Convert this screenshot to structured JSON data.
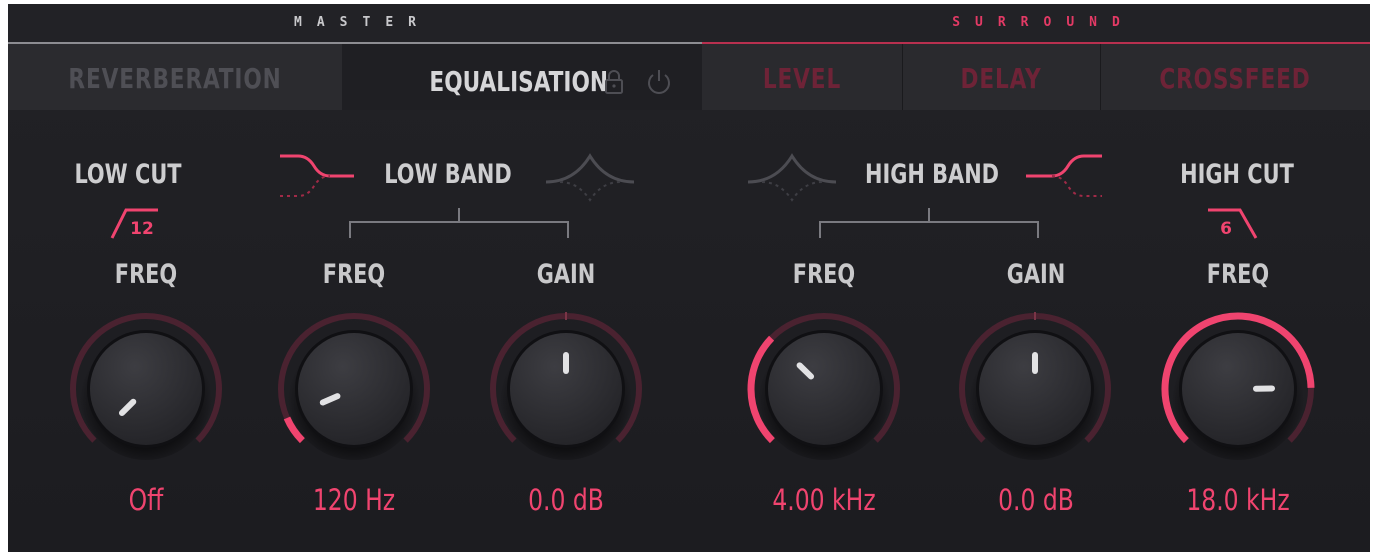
{
  "sections": {
    "master": "MASTER",
    "surround": "SURROUND"
  },
  "tabs": [
    {
      "label": "REVERBERATION",
      "active": false
    },
    {
      "label": "EQUALISATION",
      "active": true
    },
    {
      "label": "LEVEL",
      "active": false
    },
    {
      "label": "DELAY",
      "active": false
    },
    {
      "label": "CROSSFEED",
      "active": false
    }
  ],
  "icons": {
    "lock": "lock-icon",
    "power": "power-icon"
  },
  "eq": {
    "low_cut": {
      "title": "LOW CUT",
      "slope": "12",
      "param": "FREQ",
      "value": "Off",
      "level": 0.0
    },
    "low_band": {
      "title": "LOW BAND",
      "freq": {
        "param": "FREQ",
        "value": "120 Hz",
        "level": 0.08
      },
      "gain": {
        "param": "GAIN",
        "value": "0.0 dB",
        "level": 0.5
      }
    },
    "high_band": {
      "title": "HIGH BAND",
      "freq": {
        "param": "FREQ",
        "value": "4.00 kHz",
        "level": 0.33
      },
      "gain": {
        "param": "GAIN",
        "value": "0.0 dB",
        "level": 0.5
      }
    },
    "high_cut": {
      "title": "HIGH CUT",
      "slope": "6",
      "param": "FREQ",
      "value": "18.0 kHz",
      "level": 0.83
    }
  },
  "colors": {
    "accent": "#f0446f",
    "accent_dim": "#4a2230",
    "text": "#cdcdcf",
    "background": "#1f1f23"
  }
}
